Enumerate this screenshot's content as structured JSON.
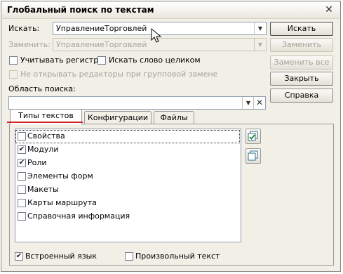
{
  "window": {
    "title": "Глобальный поиск по текстам"
  },
  "form": {
    "search_label": "Искать:",
    "search_value": "УправлениеТорговлей",
    "replace_label": "Заменить:",
    "replace_value": "УправлениеТорговлей",
    "match_case_label": "Учитывать регистр",
    "whole_word_label": "Искать слово целиком",
    "no_editors_label": "Не открывать редакторы при групповой замене",
    "scope_label": "Область поиска:",
    "scope_value": ""
  },
  "buttons": {
    "search": "Искать",
    "replace": "Заменить",
    "replace_all": "Заменить все",
    "close": "Закрыть",
    "help": "Справка"
  },
  "tabs": [
    {
      "label": "Типы текстов",
      "active": true
    },
    {
      "label": "Конфигурации",
      "active": false
    },
    {
      "label": "Файлы",
      "active": false
    }
  ],
  "text_types": [
    {
      "label": "Свойства",
      "checked": false
    },
    {
      "label": "Модули",
      "checked": true
    },
    {
      "label": "Роли",
      "checked": true
    },
    {
      "label": "Элементы форм",
      "checked": false
    },
    {
      "label": "Макеты",
      "checked": false
    },
    {
      "label": "Карты маршрута",
      "checked": false
    },
    {
      "label": "Справочная информация",
      "checked": false
    }
  ],
  "bottom": {
    "builtin_label": "Встроенный язык",
    "builtin_checked": true,
    "arbitrary_label": "Произвольный текст",
    "arbitrary_checked": false
  },
  "icons": {
    "close": "close-icon",
    "dropdown": "chevron-down-icon",
    "clear": "clear-icon",
    "check_all": "check-all-icon",
    "uncheck_all": "uncheck-all-icon",
    "cursor": "mouse-cursor-icon"
  },
  "colors": {
    "window_bg": "#f1efe6",
    "underline_accent": "#d32020"
  }
}
